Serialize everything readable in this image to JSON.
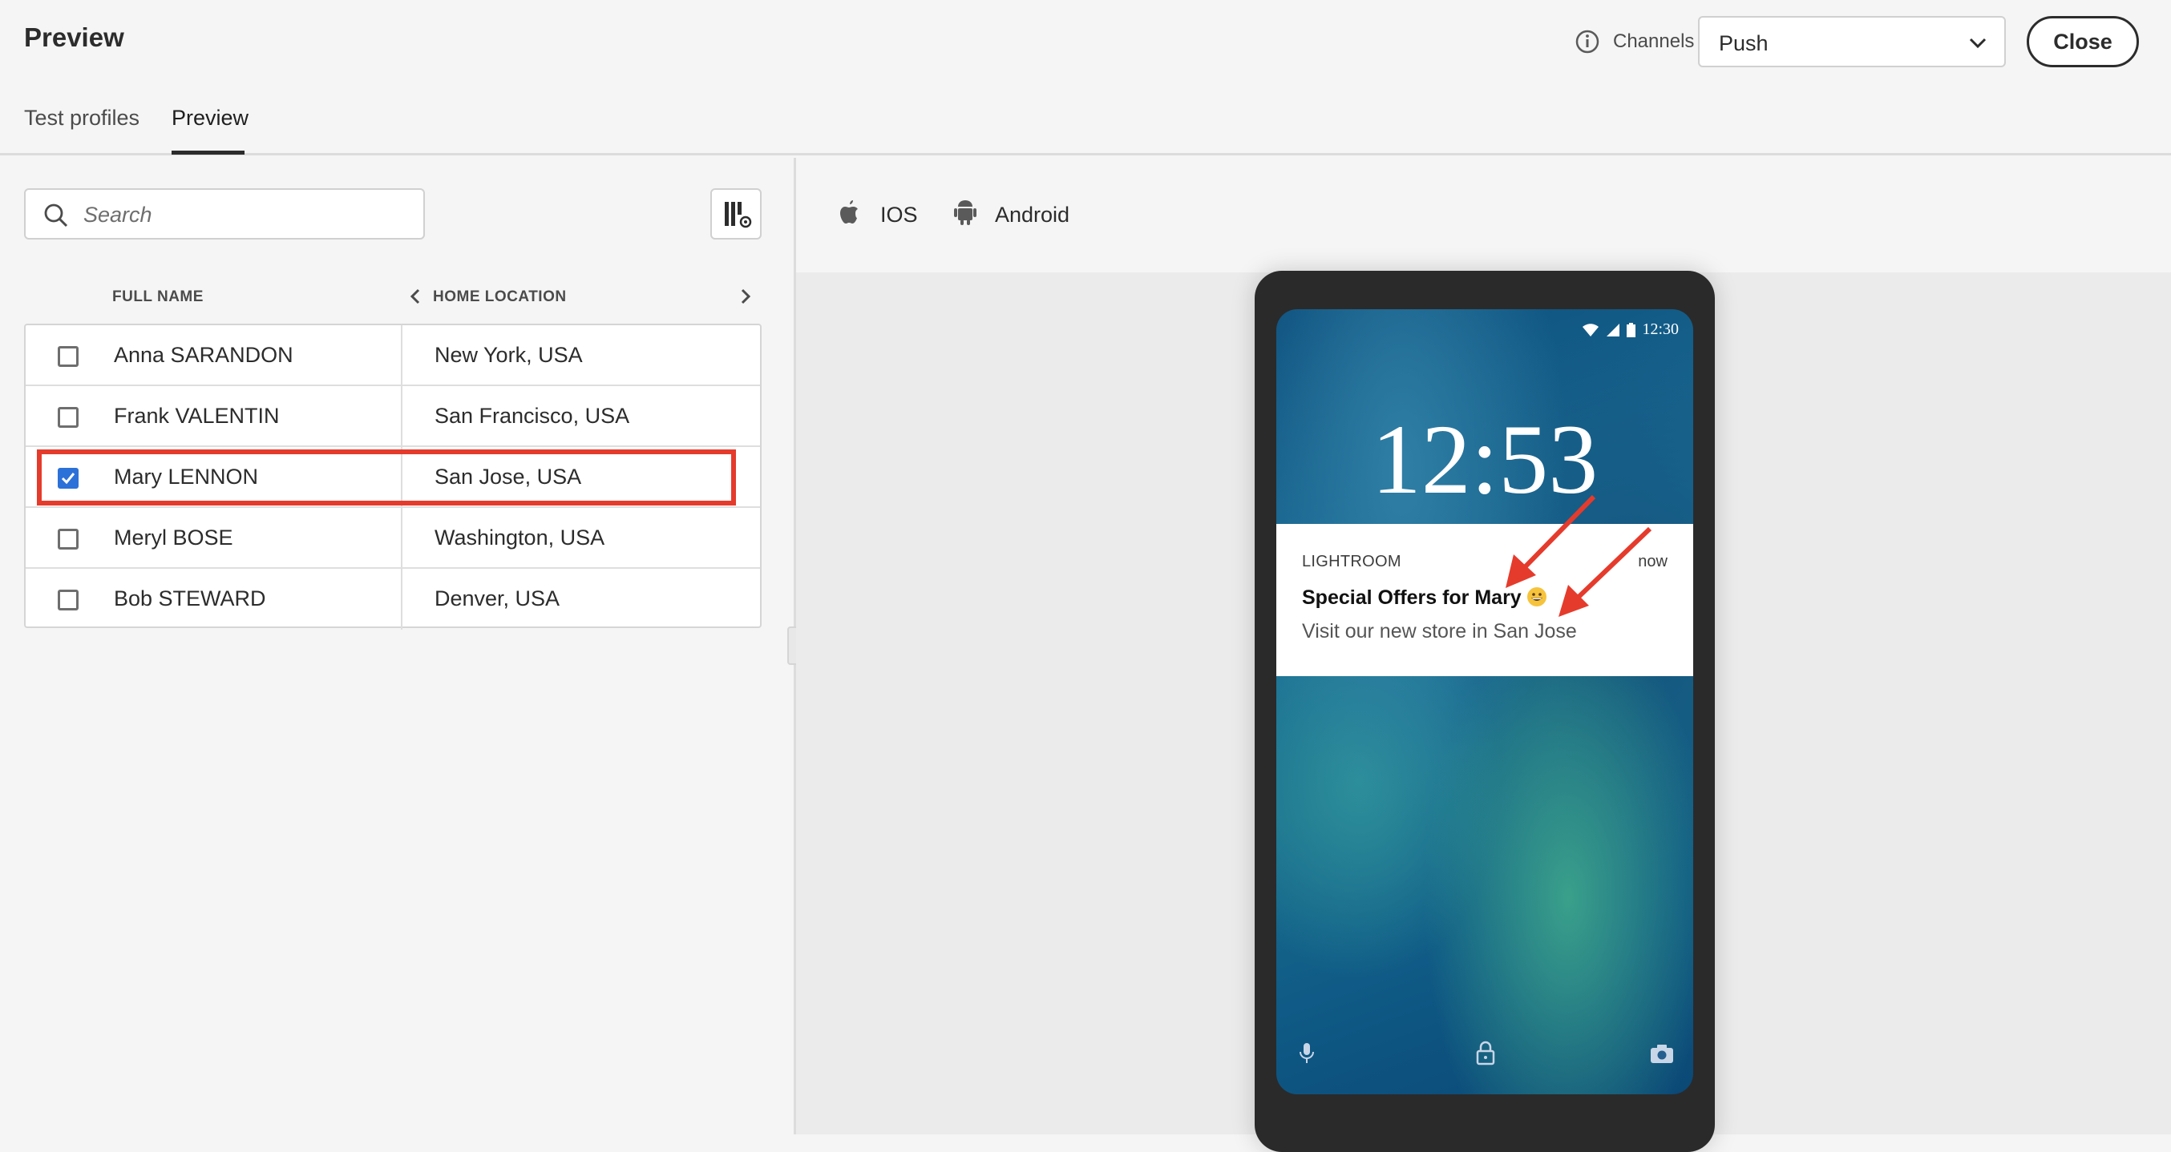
{
  "header": {
    "title": "Preview",
    "tabs": [
      {
        "label": "Test profiles",
        "active": false
      },
      {
        "label": "Preview",
        "active": true
      }
    ],
    "channels_label": "Channels",
    "channel_value": "Push",
    "close_label": "Close"
  },
  "left": {
    "search_placeholder": "Search",
    "columns": {
      "full_name": "FULL NAME",
      "home_location": "HOME LOCATION"
    },
    "rows": [
      {
        "name": "Anna SARANDON",
        "location": "New York, USA",
        "checked": false
      },
      {
        "name": "Frank VALENTIN",
        "location": "San Francisco, USA",
        "checked": false
      },
      {
        "name": "Mary LENNON",
        "location": "San Jose, USA",
        "checked": true
      },
      {
        "name": "Meryl BOSE",
        "location": "Washington, USA",
        "checked": false
      },
      {
        "name": "Bob STEWARD",
        "location": "Denver, USA",
        "checked": false
      }
    ]
  },
  "right": {
    "platforms": [
      {
        "label": "IOS",
        "icon": "apple-icon"
      },
      {
        "label": "Android",
        "icon": "android-icon"
      }
    ],
    "phone": {
      "status_time": "12:30",
      "clock": "12:53",
      "notification": {
        "app": "LIGHTROOM",
        "time": "now",
        "title": "Special Offers for Mary",
        "body": "Visit our new store in San Jose"
      }
    }
  },
  "colors": {
    "accent": "#2c71d8",
    "highlight": "#e53b2c",
    "text": "#2c2c2c"
  }
}
